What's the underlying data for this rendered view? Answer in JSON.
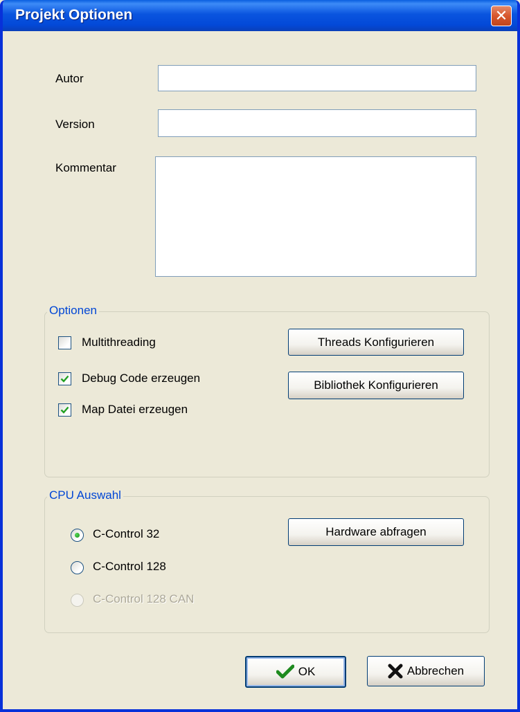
{
  "window": {
    "title": "Projekt Optionen"
  },
  "fields": {
    "autor_label": "Autor",
    "autor_value": "",
    "version_label": "Version",
    "version_value": "",
    "kommentar_label": "Kommentar",
    "kommentar_value": ""
  },
  "optionen": {
    "legend": "Optionen",
    "multithreading": {
      "label": "Multithreading",
      "checked": false
    },
    "debug_code": {
      "label": "Debug Code erzeugen",
      "checked": true
    },
    "map_datei": {
      "label": "Map Datei erzeugen",
      "checked": true
    },
    "threads_button": "Threads Konfigurieren",
    "bibliothek_button": "Bibliothek Konfigurieren"
  },
  "cpu": {
    "legend": "CPU Auswahl",
    "options": [
      {
        "label": "C-Control 32",
        "selected": true,
        "enabled": true
      },
      {
        "label": "C-Control 128",
        "selected": false,
        "enabled": true
      },
      {
        "label": "C-Control 128 CAN",
        "selected": false,
        "enabled": false
      }
    ],
    "hardware_button": "Hardware abfragen"
  },
  "buttons": {
    "ok": "OK",
    "cancel": "Abbrechen"
  },
  "colors": {
    "titlebar": "#0a55df",
    "dialog_bg": "#ece9d8",
    "legend_text": "#0046d5",
    "check_green": "#21a121",
    "cancel_x": "#000000",
    "close_button": "#d8572d"
  },
  "icons": {
    "close": "close-icon",
    "ok": "checkmark-icon",
    "cancel": "x-icon"
  }
}
